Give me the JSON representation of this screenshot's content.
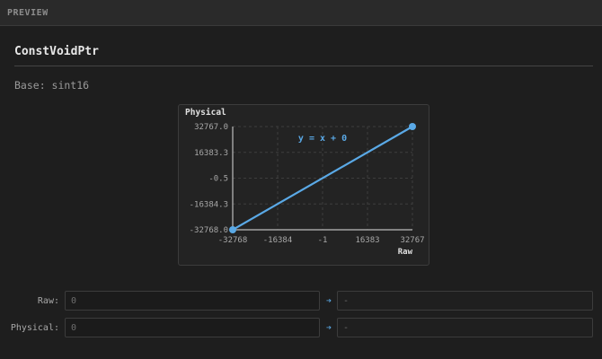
{
  "panel": {
    "title": "PREVIEW"
  },
  "type_name": "ConstVoidPtr",
  "base": {
    "label": "Base:",
    "value": "sint16",
    "text": "Base: sint16"
  },
  "chart_data": {
    "type": "line",
    "ylabel": "Physical",
    "xlabel": "Raw",
    "equation": "y = x + 0",
    "x_ticks": [
      "-32768",
      "-16384",
      "-1",
      "16383",
      "32767"
    ],
    "y_ticks": [
      "32767.0",
      "16383.3",
      "-0.5",
      "-16384.3",
      "-32768.0"
    ],
    "xlim": [
      -32768,
      32767
    ],
    "ylim": [
      -32768,
      32767
    ],
    "grid": true,
    "series": [
      {
        "x": [
          -32768,
          32767
        ],
        "y": [
          -32768,
          32767
        ]
      }
    ],
    "line_color": "#5aa9e6"
  },
  "converter": {
    "raw": {
      "label": "Raw:",
      "input_placeholder": "0",
      "output_placeholder": "-"
    },
    "physical": {
      "label": "Physical:",
      "input_placeholder": "0",
      "output_placeholder": "-"
    },
    "arrow": "➔"
  }
}
